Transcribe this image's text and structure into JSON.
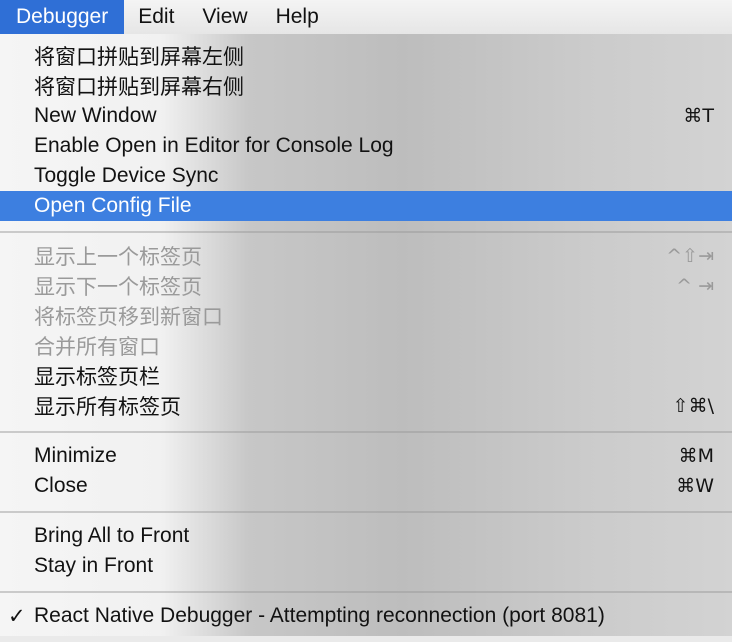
{
  "menubar": {
    "items": [
      "Debugger",
      "Edit",
      "View",
      "Help"
    ]
  },
  "menu": {
    "snap_left": "将窗口拼贴到屏幕左侧",
    "snap_right": "将窗口拼贴到屏幕右侧",
    "new_window": {
      "label": "New Window",
      "shortcut": "⌘T"
    },
    "enable_open_in_editor": "Enable Open in Editor for Console Log",
    "toggle_device_sync": "Toggle Device Sync",
    "open_config_file": "Open Config File",
    "prev_tab": {
      "label": "显示上一个标签页",
      "shortcut": "^⇧⇥"
    },
    "next_tab": {
      "label": "显示下一个标签页",
      "shortcut": "^ ⇥"
    },
    "move_tab": "将标签页移到新窗口",
    "merge_windows": "合并所有窗口",
    "show_tab_bar": "显示标签页栏",
    "show_all_tabs": {
      "label": "显示所有标签页",
      "shortcut": "⇧⌘\\"
    },
    "minimize": {
      "label": "Minimize",
      "shortcut": "⌘M"
    },
    "close": {
      "label": "Close",
      "shortcut": "⌘W"
    },
    "bring_all_to_front": "Bring All to Front",
    "stay_in_front": "Stay in Front",
    "window_item": {
      "check": "✓",
      "label": "React Native Debugger - Attempting reconnection (port 8081)"
    }
  },
  "colors": {
    "selection": "#3d7fe0",
    "menubar_active": "#2f6fd6",
    "disabled_text": "#9a9a9a"
  }
}
